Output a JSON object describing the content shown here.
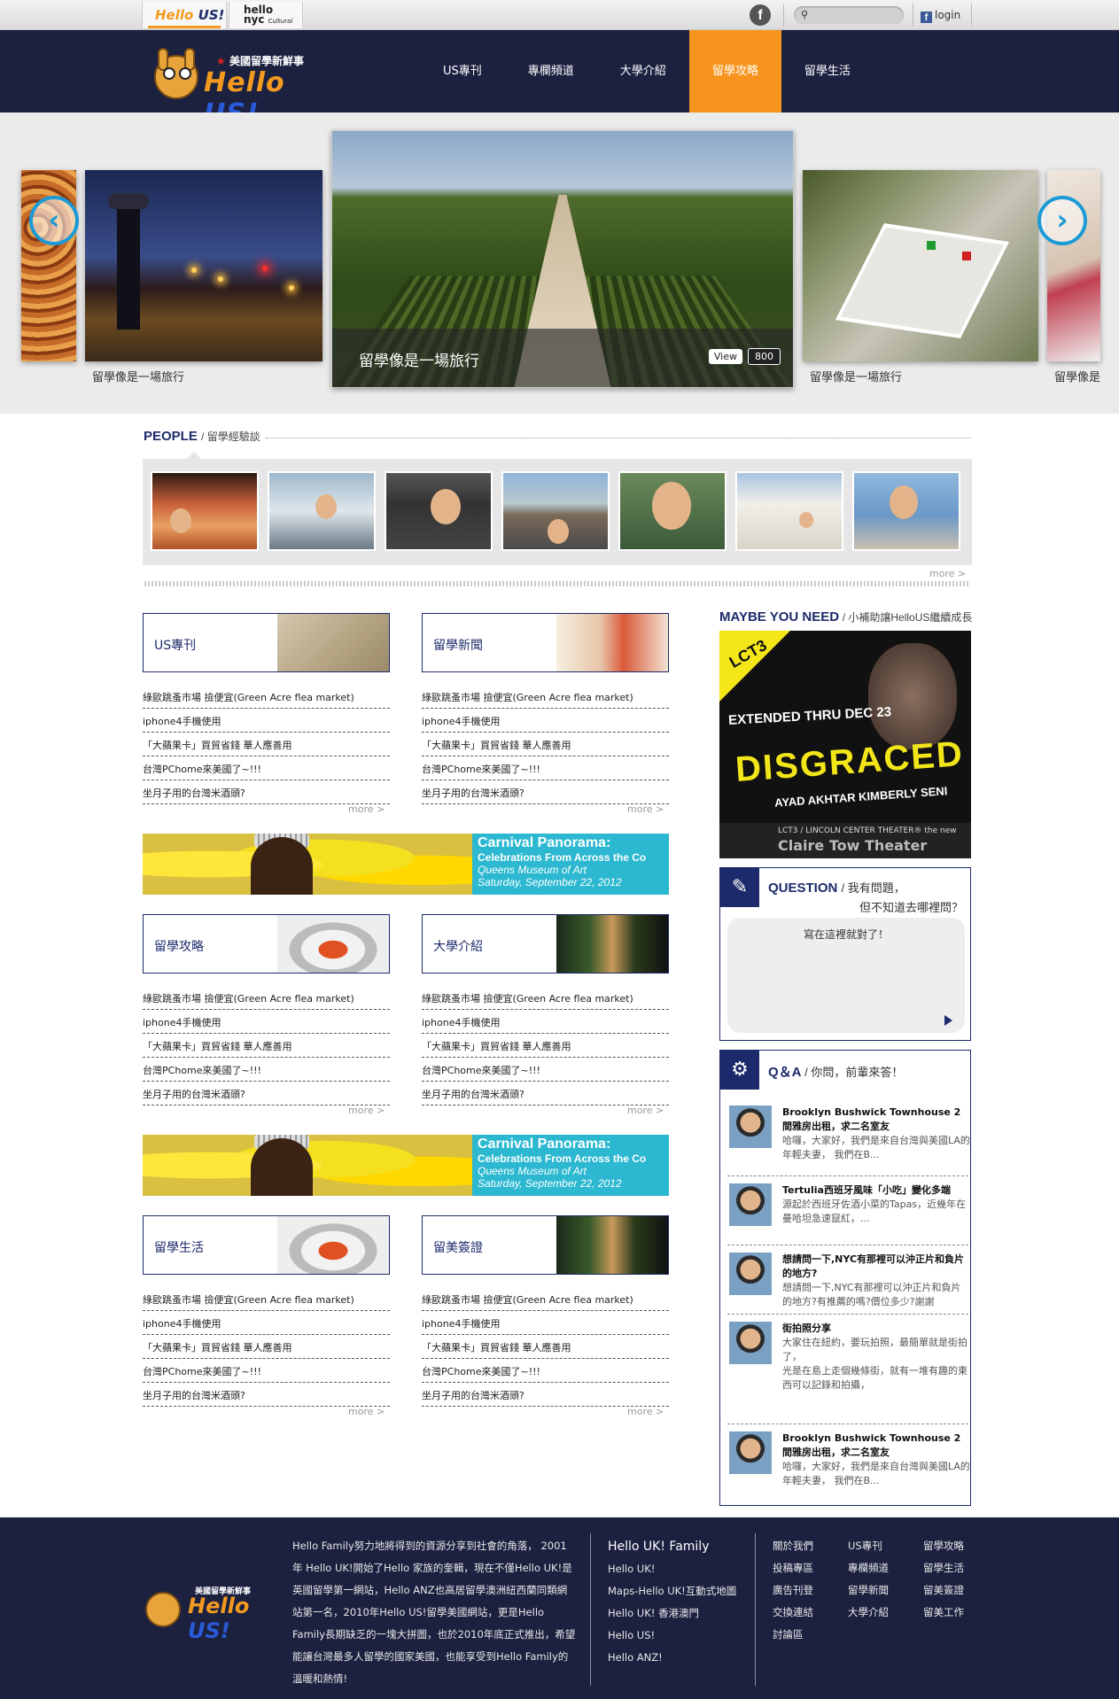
{
  "topbar": {
    "search_placeholder": "",
    "login": "login",
    "tab_hellous": {
      "a": "Hello",
      "b": "US!"
    },
    "tab_nyc": {
      "a": "hello",
      "b": "nyc",
      "c": "Cultural"
    }
  },
  "header": {
    "brand_tag": "美國留學新鮮事",
    "brand_word_a": "Hello",
    "brand_word_b": "US!",
    "nav": [
      {
        "label": "US專刊",
        "active": false
      },
      {
        "label": "專欄頻道",
        "active": false
      },
      {
        "label": "大學介紹",
        "active": false
      },
      {
        "label": "留學攻略",
        "active": true
      },
      {
        "label": "留學生活",
        "active": false
      }
    ]
  },
  "slider": {
    "captions": [
      "留學像是一場旅行",
      "留學像是一場旅行",
      "留學像是"
    ],
    "main_title": "留學像是一場旅行",
    "view_label": "View",
    "view_count": "800"
  },
  "people": {
    "title": "PEOPLE",
    "subtitle": "/ 留學經驗談",
    "more": "more >"
  },
  "columns": {
    "more": "more >",
    "items": [
      "綠歐跳蚤市場 撿便宜(Green Acre flea market)",
      "iphone4手機使用",
      "「大蘋果卡」買貿省錢 華人應善用",
      "台灣PChome來美國了~!!!",
      "坐月子用的台灣米酒頭?"
    ],
    "blocks": [
      {
        "title": "US專刊"
      },
      {
        "title": "留學新聞"
      },
      {
        "title": "留學攻略"
      },
      {
        "title": "大學介紹"
      },
      {
        "title": "留學生活"
      },
      {
        "title": "留美簽證"
      }
    ],
    "banner": {
      "line1": "Carnival Panorama:",
      "line2": "Celebrations From Across the Co",
      "line3": "Queens Museum of Art",
      "line4": "Saturday, September 22, 2012"
    }
  },
  "sidebar": {
    "maybe_title": "MAYBE YOU NEED",
    "maybe_sub": "/ 小補助讓HelloUS繼續成長",
    "ad": {
      "badge": "LCT3",
      "extended": "EXTENDED THRU DEC 23",
      "play": "DISGRACED",
      "author": "AYAD AKHTAR   KIMBERLY SENI",
      "small": "LCT3 / LINCOLN CENTER THEATER® the new",
      "theater": "Claire Tow Theater"
    },
    "question": {
      "title": "QUESTION",
      "sub1": "/ 我有問題，",
      "sub2": "但不知道去哪裡問？",
      "hint": "寫在這裡就對了！"
    },
    "qa": {
      "title": "Q＆A",
      "sub": "/ 你問，前輩來答！",
      "items": [
        {
          "title": "Brooklyn Bushwick Townhouse 2間雅房出租，求二名室友",
          "desc": "哈囉，大家好，我們是來自台灣與美國LA的年輕夫妻， 我們在B..."
        },
        {
          "title": "Tertulia西班牙風味「小吃」變化多端",
          "desc": "源起於西班牙佐酒小菜的Tapas，近幾年在曼哈坦急速竄紅，..."
        },
        {
          "title": "想請問一下,NYC有那裡可以沖正片和負片的地方?",
          "desc": "想請問一下,NYC有那裡可以沖正片和負片的地方?有推薦的嗎?價位多少?謝謝"
        },
        {
          "title": "街拍照分享",
          "desc": "大家住在紐約，要玩拍照，最簡單就是街拍了，\n光是在島上走個幾條街，就有一堆有趣的東西可以記錄和拍攝，"
        },
        {
          "title": "Brooklyn Bushwick Townhouse 2間雅房出租，求二名室友",
          "desc": "哈囉，大家好，我們是來自台灣與美國LA的年輕夫妻， 我們在B..."
        }
      ]
    }
  },
  "footer": {
    "brand_tag": "美國留學新鮮事",
    "brand_word_a": "Hello",
    "brand_word_b": "US!",
    "about": "Hello Family努力地將得到的資源分享到社會的角落， 2001年 Hello UK!開始了Hello 家族的奎輯，現在不僅Hello UK!是英國留學第一網站，Hello ANZ也高居留學澳洲紐西蘭同類網站第一名，2010年Hello US!留學美國網站，更是Hello Family長期缺乏的一塊大拼圖，也於2010年底正式推出，希望能讓台灣最多人留學的國家美國，也能享受到Hello Family的溫暖和熱情!",
    "family_title": "Hello UK!  Family",
    "family_links": [
      "Hello UK!",
      "Maps-Hello UK!互動式地圖",
      "Hello UK! 香港澳門",
      "Hello US!",
      "Hello ANZ!"
    ],
    "links": [
      "關於我們",
      "US專刊",
      "留學攻略",
      "投稿專區",
      "專欄頻道",
      "留學生活",
      "廣告刊登",
      "留學新聞",
      "留美簽證",
      "交換連結",
      "大學介紹",
      "留美工作",
      "討論區"
    ]
  }
}
